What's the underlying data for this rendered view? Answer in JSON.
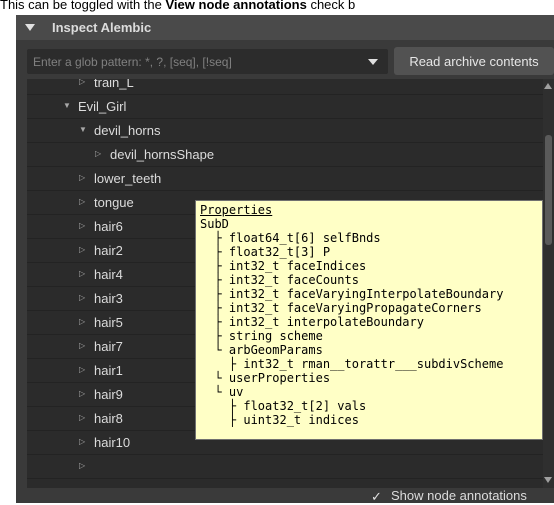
{
  "caption": {
    "prefix": "This can be toggled with the ",
    "bold": "View node annotations",
    "suffix": " check b"
  },
  "panel": {
    "title": "Inspect Alembic",
    "glob_placeholder": "Enter a glob pattern: *, ?, [seq], [!seq]",
    "read_button": "Read archive contents",
    "annotations_checkbox": {
      "label": "Show node annotations",
      "checked": true,
      "glyph": "✓"
    }
  },
  "tree": {
    "rows": [
      {
        "label": "train_L",
        "indent": 2,
        "expanded": false
      },
      {
        "label": "Evil_Girl",
        "indent": 1,
        "expanded": true
      },
      {
        "label": "devil_horns",
        "indent": 2,
        "expanded": true
      },
      {
        "label": "devil_hornsShape",
        "indent": 3,
        "expanded": false
      },
      {
        "label": "lower_teeth",
        "indent": 2,
        "expanded": false
      },
      {
        "label": "tongue",
        "indent": 2,
        "expanded": false
      },
      {
        "label": "hair6",
        "indent": 2,
        "expanded": false
      },
      {
        "label": "hair2",
        "indent": 2,
        "expanded": false
      },
      {
        "label": "hair4",
        "indent": 2,
        "expanded": false
      },
      {
        "label": "hair3",
        "indent": 2,
        "expanded": false
      },
      {
        "label": "hair5",
        "indent": 2,
        "expanded": false
      },
      {
        "label": "hair7",
        "indent": 2,
        "expanded": false
      },
      {
        "label": "hair1",
        "indent": 2,
        "expanded": false
      },
      {
        "label": "hair9",
        "indent": 2,
        "expanded": false
      },
      {
        "label": "hair8",
        "indent": 2,
        "expanded": false
      },
      {
        "label": "hair10",
        "indent": 2,
        "expanded": false
      },
      {
        "label": "",
        "indent": 2,
        "expanded": false
      }
    ]
  },
  "tooltip": {
    "title": "Properties",
    "lines": [
      "SubD",
      "  ├ float64_t[6] selfBnds",
      "  ├ float32_t[3] P",
      "  ├ int32_t faceIndices",
      "  ├ int32_t faceCounts",
      "  ├ int32_t faceVaryingInterpolateBoundary",
      "  ├ int32_t faceVaryingPropagateCorners",
      "  ├ int32_t interpolateBoundary",
      "  ├ string scheme",
      "  └ arbGeomParams",
      "    ├ int32_t rman__torattr___subdivScheme",
      "  └ userProperties",
      "  └ uv",
      "    ├ float32_t[2] vals",
      "    ├ uint32_t indices"
    ]
  },
  "colors": {
    "panel_bg": "#3a3a3a",
    "tree_bg": "#2b2b2b",
    "tooltip_bg": "#ffffc6",
    "text": "#dcdcdc"
  },
  "icons": {
    "header_collapse": "triangle-down-icon",
    "dropdown": "chevron-down-icon",
    "collapsed_node": "triangle-right-icon",
    "expanded_node": "triangle-down-icon",
    "checkbox": "checkmark-icon"
  }
}
